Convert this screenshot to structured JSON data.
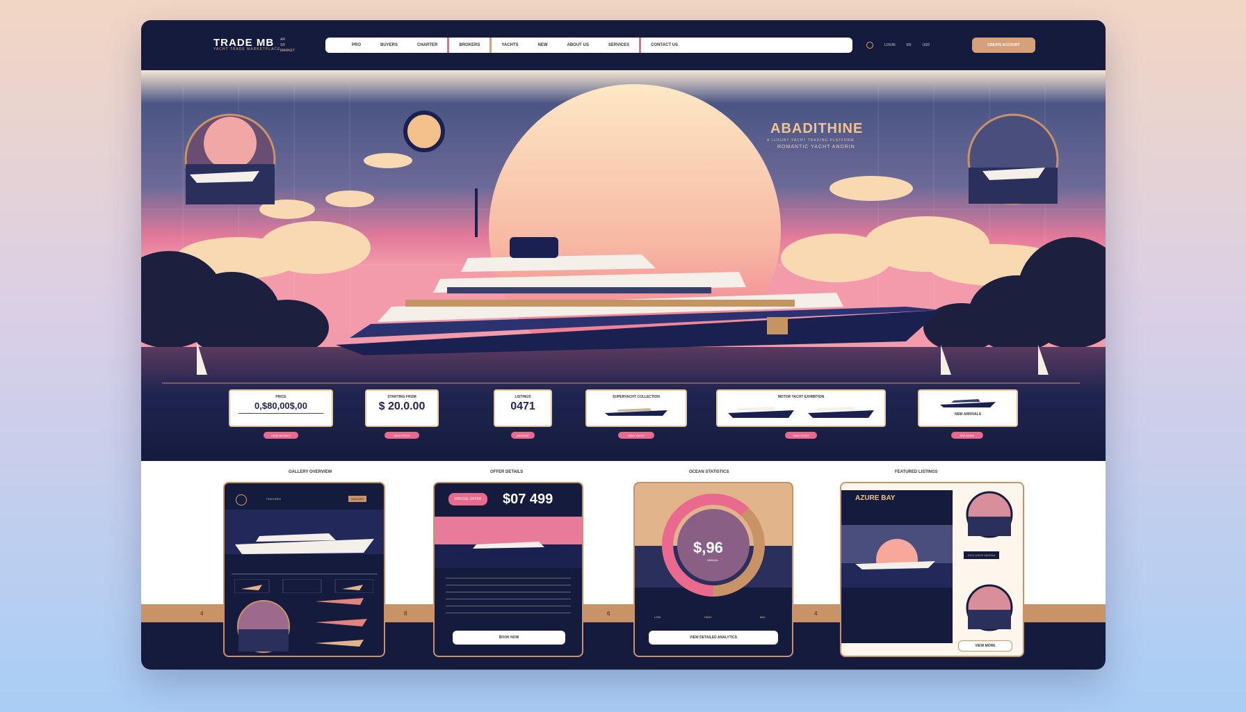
{
  "header": {
    "logo": "TRADE MB",
    "logo_small": "YACHT TRADE MARKETPLACE",
    "logo_sub": [
      "AR",
      "SR",
      "MARKET"
    ],
    "nav": [
      "PRO",
      "BUYERS",
      "CHARTER",
      "BROKERS",
      "YACHTS",
      "NEW",
      "ABOUT US",
      "SERVICES",
      "CONTACT US"
    ],
    "nav_right": [
      "LOGIN",
      "EN",
      "USD"
    ],
    "cta": "CREATE ACCOUNT"
  },
  "hero": {
    "brand_title": "ABADITHINE",
    "brand_sub1": "A LUXURY YACHT TRADING PLATFORM",
    "brand_sub2": "ROMANTIC YACHT ANDRIN",
    "stats": [
      {
        "label": "PRICE",
        "value": "0,$80,00$,00",
        "pill": "VIEW DETAILS"
      },
      {
        "label": "STARTING FROM",
        "value": "$ 20.0.00",
        "pill": "VIEW PRICE"
      },
      {
        "label": "LISTINGS",
        "value": "0471",
        "pill": "BROWSE"
      },
      {
        "label": "SUPERYACHT COLLECTION",
        "value": "",
        "pill": "VIEW YACHT"
      },
      {
        "label": "MOTOR YACHT EXHIBITION",
        "value": "",
        "pill": "VIEW FLEET"
      },
      {
        "label": "NEW ARRIVALS",
        "value": "",
        "pill": "SEE MORE"
      }
    ]
  },
  "sections": {
    "titles": [
      "GALLERY OVERVIEW",
      "OFFER DETAILS",
      "OCEAN STATISTICS",
      "FEATURED LISTINGS"
    ],
    "band_numbers": [
      "4",
      "8",
      "6",
      "4"
    ]
  },
  "cards": {
    "gallery": {
      "badge": "GALLERY",
      "label": "FEATURED"
    },
    "offer": {
      "tag": "SPECIAL OFFER",
      "price": "$07 499",
      "button": "BOOK NOW"
    },
    "stats": {
      "value": "$,96",
      "caption": "ANNUAL",
      "legend": [
        "LOW",
        "HIGH",
        "MID"
      ],
      "button": "VIEW DETAILED ANALYTICS",
      "gauge_fill": 0.62
    },
    "featured": {
      "title": "AZURE BAY",
      "caption": "EXCLUSIVE MARINA",
      "button": "VIEW MORE"
    }
  },
  "colors": {
    "navy": "#151b3d",
    "gold": "#c89467",
    "pink": "#e96a8e",
    "peach": "#f0c48e"
  }
}
